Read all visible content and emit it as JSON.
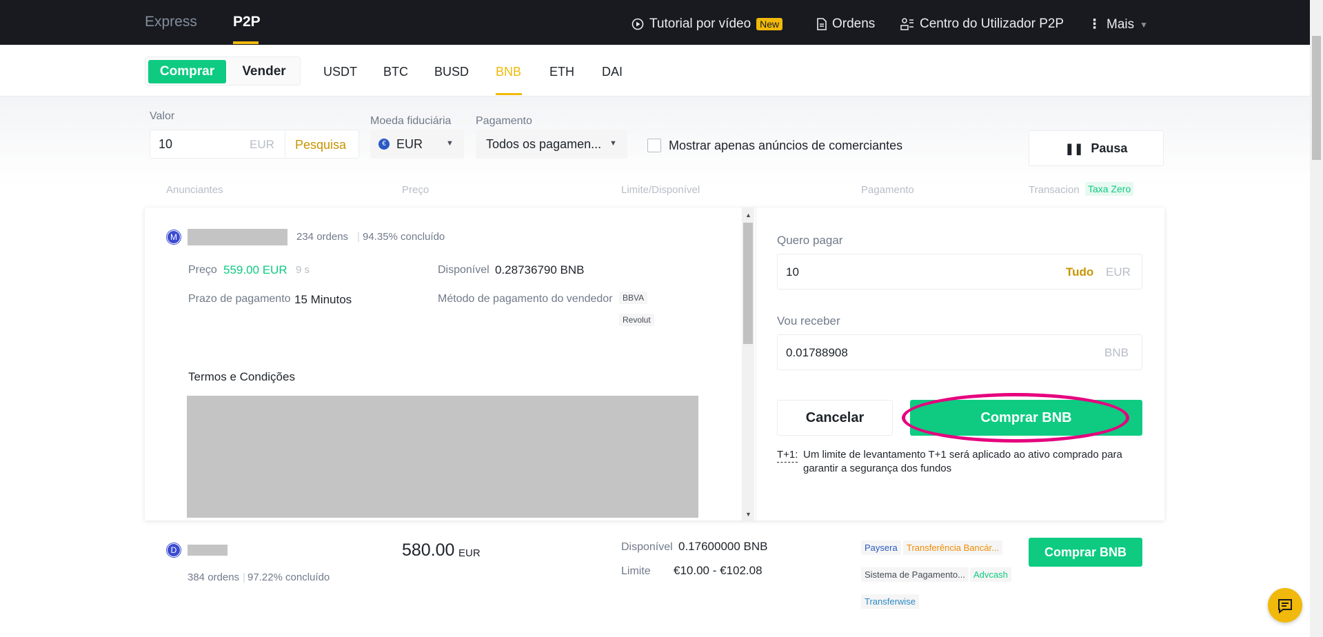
{
  "topbar": {
    "modes": [
      "Express",
      "P2P"
    ],
    "tutorial": "Tutorial por vídeo",
    "new_badge": "New",
    "orders": "Ordens",
    "user_center": "Centro do Utilizador P2P",
    "more": "Mais"
  },
  "subbar": {
    "buy": "Comprar",
    "sell": "Vender",
    "coins": [
      "USDT",
      "BTC",
      "BUSD",
      "BNB",
      "ETH",
      "DAI"
    ],
    "active_coin": "BNB"
  },
  "filters": {
    "valor_label": "Valor",
    "valor_value": "10",
    "valor_currency": "EUR",
    "search": "Pesquisa",
    "fiat_label": "Moeda fiduciária",
    "fiat_value": "EUR",
    "payment_label": "Pagamento",
    "payment_value": "Todos os pagamen...",
    "merchant_only": "Mostrar apenas anúncios de comerciantes",
    "pause": "Pausa"
  },
  "columns": {
    "advertisers": "Anunciantes",
    "price": "Preço",
    "limit": "Limite/Disponível",
    "payment": "Pagamento",
    "transaction": "Transacion",
    "zero_fee": "Taxa Zero"
  },
  "expanded_ad": {
    "avatar": "M",
    "orders": "234 ordens",
    "completion": "94.35% concluído",
    "price_label": "Preço",
    "price": "559.00 EUR",
    "price_age": "9 s",
    "available_label": "Disponível",
    "available": "0.28736790 BNB",
    "payment_time_label": "Prazo de pagamento",
    "payment_time": "15 Minutos",
    "seller_method_label": "Método de pagamento do vendedor",
    "methods": [
      "BBVA",
      "Revolut"
    ],
    "terms_title": "Termos e Condições"
  },
  "order_form": {
    "pay_label": "Quero pagar",
    "pay_value": "10",
    "all": "Tudo",
    "pay_currency": "EUR",
    "receive_label": "Vou receber",
    "receive_value": "0.01788908",
    "receive_currency": "BNB",
    "cancel": "Cancelar",
    "buy": "Comprar BNB",
    "t1_label": "T+1:",
    "t1_text": "Um limite de levantamento T+1 será aplicado ao ativo comprado para garantir a segurança dos fundos"
  },
  "second_ad": {
    "avatar": "D",
    "orders": "384 ordens",
    "completion": "97.22% concluído",
    "price": "580.00",
    "price_currency": "EUR",
    "available_label": "Disponível",
    "available": "0.17600000 BNB",
    "limit_label": "Limite",
    "limit": "€10.00 - €102.08",
    "payments": [
      "Paysera",
      "Transferência Bancár...",
      "Sistema de Pagamento...",
      "Advcash",
      "Transferwise"
    ],
    "buy": "Comprar BNB"
  },
  "colors": {
    "accent": "#f0b90b",
    "buy_green": "#0ecb81",
    "highlight": "#e6007e"
  }
}
